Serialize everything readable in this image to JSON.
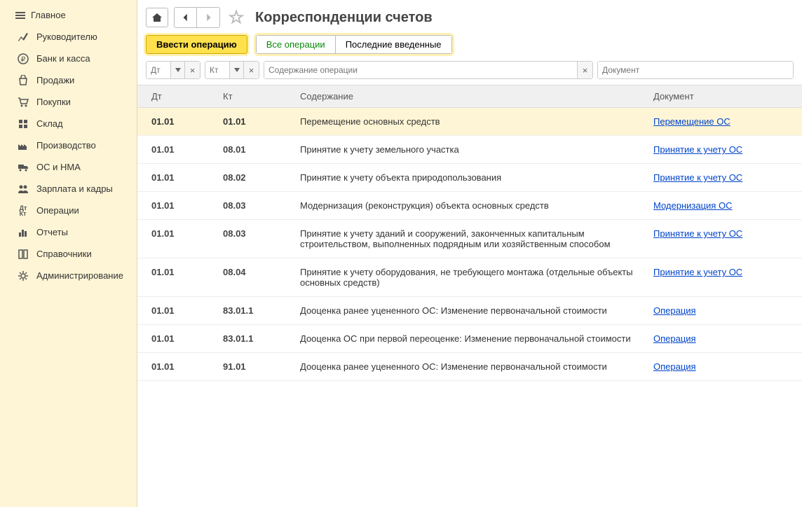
{
  "sidebar": {
    "items": [
      {
        "label": "Главное"
      },
      {
        "label": "Руководителю"
      },
      {
        "label": "Банк и касса"
      },
      {
        "label": "Продажи"
      },
      {
        "label": "Покупки"
      },
      {
        "label": "Склад"
      },
      {
        "label": "Производство"
      },
      {
        "label": "ОС и НМА"
      },
      {
        "label": "Зарплата и кадры"
      },
      {
        "label": "Операции"
      },
      {
        "label": "Отчеты"
      },
      {
        "label": "Справочники"
      },
      {
        "label": "Администрирование"
      }
    ]
  },
  "page": {
    "title": "Корреспонденции счетов"
  },
  "toolbar": {
    "primary": "Ввести операцию",
    "seg_all": "Все операции",
    "seg_recent": "Последние введенные"
  },
  "filters": {
    "dt": "Дт",
    "kt": "Кт",
    "desc": "Содержание операции",
    "doc": "Документ"
  },
  "table": {
    "head": {
      "dt": "Дт",
      "kt": "Кт",
      "desc": "Содержание",
      "doc": "Документ"
    },
    "rows": [
      {
        "dt": "01.01",
        "kt": "01.01",
        "desc": "Перемещение основных средств",
        "doc": "Перемещение ОС",
        "selected": true
      },
      {
        "dt": "01.01",
        "kt": "08.01",
        "desc": "Принятие к учету земельного участка",
        "doc": "Принятие к учету ОС"
      },
      {
        "dt": "01.01",
        "kt": "08.02",
        "desc": "Принятие к учету объекта природопользования",
        "doc": "Принятие к учету ОС"
      },
      {
        "dt": "01.01",
        "kt": "08.03",
        "desc": "Модернизация (реконструкция) объекта основных средств",
        "doc": "Модернизация ОС"
      },
      {
        "dt": "01.01",
        "kt": "08.03",
        "desc": "Принятие к учету зданий и сооружений, законченных капитальным строительством, выполненных подрядным или хозяйственным способом",
        "doc": "Принятие к учету ОС"
      },
      {
        "dt": "01.01",
        "kt": "08.04",
        "desc": "Принятие к учету оборудования, не требующего монтажа (отдельные объекты основных средств)",
        "doc": "Принятие к учету ОС"
      },
      {
        "dt": "01.01",
        "kt": "83.01.1",
        "desc": "Дооценка ранее уцененного ОС: Изменение первоначальной стоимости",
        "doc": "Операция"
      },
      {
        "dt": "01.01",
        "kt": "83.01.1",
        "desc": "Дооценка ОС при первой переоценке: Изменение первоначальной стоимости",
        "doc": "Операция"
      },
      {
        "dt": "01.01",
        "kt": "91.01",
        "desc": "Дооценка ранее уцененного ОС: Изменение первоначальной стоимости",
        "doc": "Операция"
      }
    ]
  }
}
